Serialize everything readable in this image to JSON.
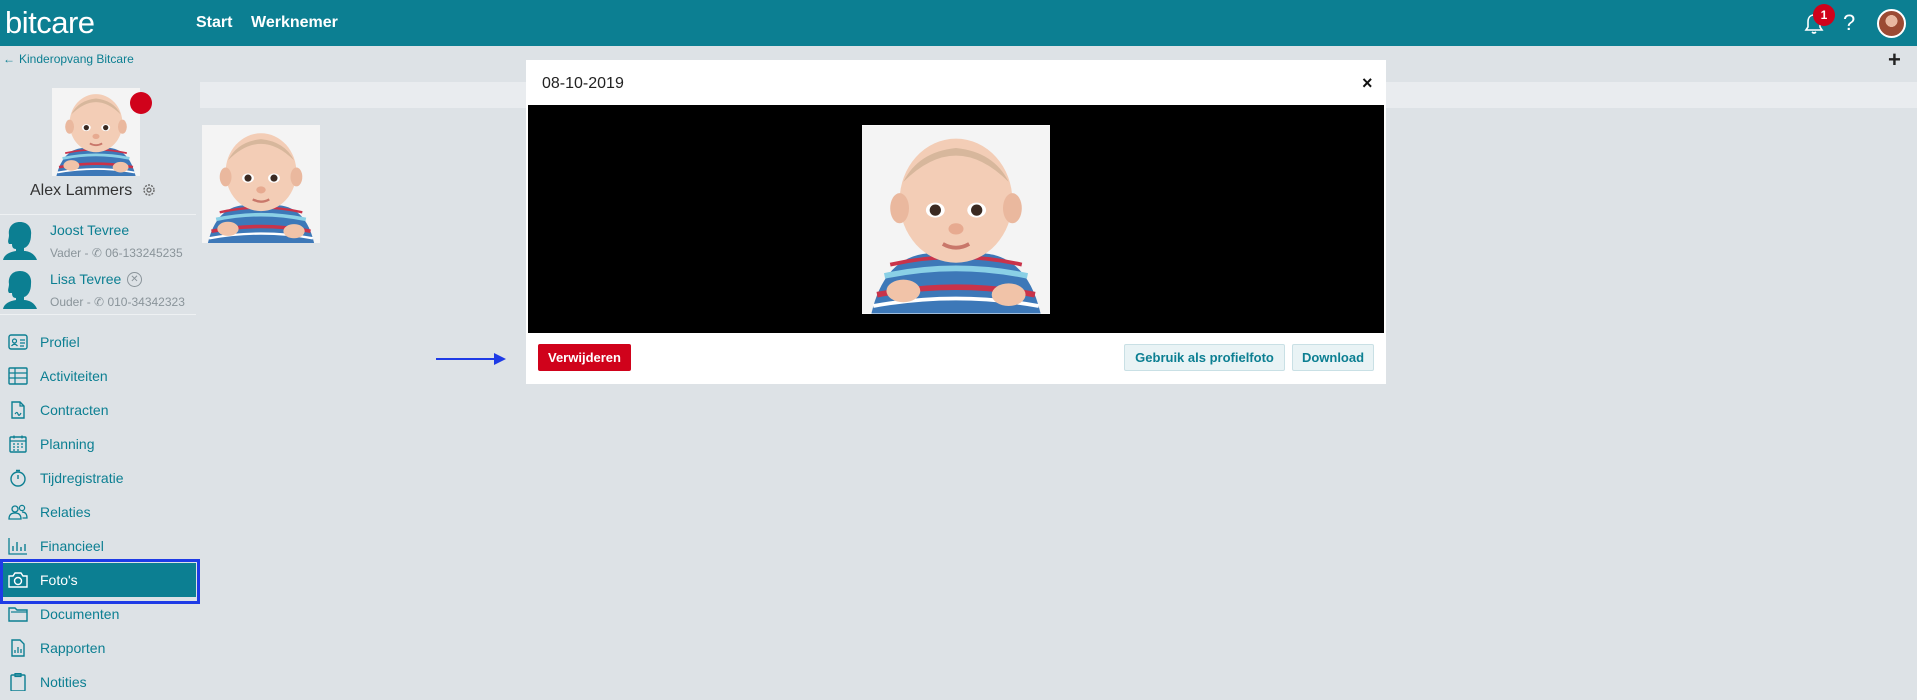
{
  "app": {
    "logo": "bitcare",
    "nav": [
      {
        "label": "Start"
      },
      {
        "label": "Werknemer"
      }
    ],
    "notifications_count": "1",
    "help_label": "?",
    "icons": {
      "bell": "bell-icon",
      "avatar": "user-avatar"
    }
  },
  "sidebar": {
    "back_label": "Kinderopvang Bitcare",
    "profile": {
      "name": "Alex Lammers",
      "status_color": "#d0021b"
    },
    "relations": [
      {
        "name": "Joost Tevree",
        "role": "Vader",
        "separator": "-",
        "phone": "06-133245235"
      },
      {
        "name": "Lisa Tevree",
        "role": "Ouder",
        "separator": "-",
        "phone": "010-34342323",
        "remove": "✕"
      }
    ],
    "menu": [
      {
        "label": "Profiel",
        "icon": "id-card-icon"
      },
      {
        "label": "Activiteiten",
        "icon": "table-icon"
      },
      {
        "label": "Contracten",
        "icon": "contract-icon"
      },
      {
        "label": "Planning",
        "icon": "calendar-icon"
      },
      {
        "label": "Tijdregistratie",
        "icon": "stopwatch-icon"
      },
      {
        "label": "Relaties",
        "icon": "people-icon"
      },
      {
        "label": "Financieel",
        "icon": "bar-chart-icon"
      },
      {
        "label": "Foto's",
        "icon": "camera-icon",
        "active": true
      },
      {
        "label": "Documenten",
        "icon": "folder-icon"
      },
      {
        "label": "Rapporten",
        "icon": "report-icon"
      },
      {
        "label": "Notities",
        "icon": "clipboard-icon"
      }
    ]
  },
  "main": {
    "add_label": "+"
  },
  "modal": {
    "title": "08-10-2019",
    "close_label": "×",
    "delete_label": "Verwijderen",
    "use_as_profile_label": "Gebruik als profielfoto",
    "download_label": "Download"
  },
  "colors": {
    "brand": "#0c7f92",
    "danger": "#d0021b",
    "highlight": "#1e3be6",
    "background": "#dde2e6"
  }
}
